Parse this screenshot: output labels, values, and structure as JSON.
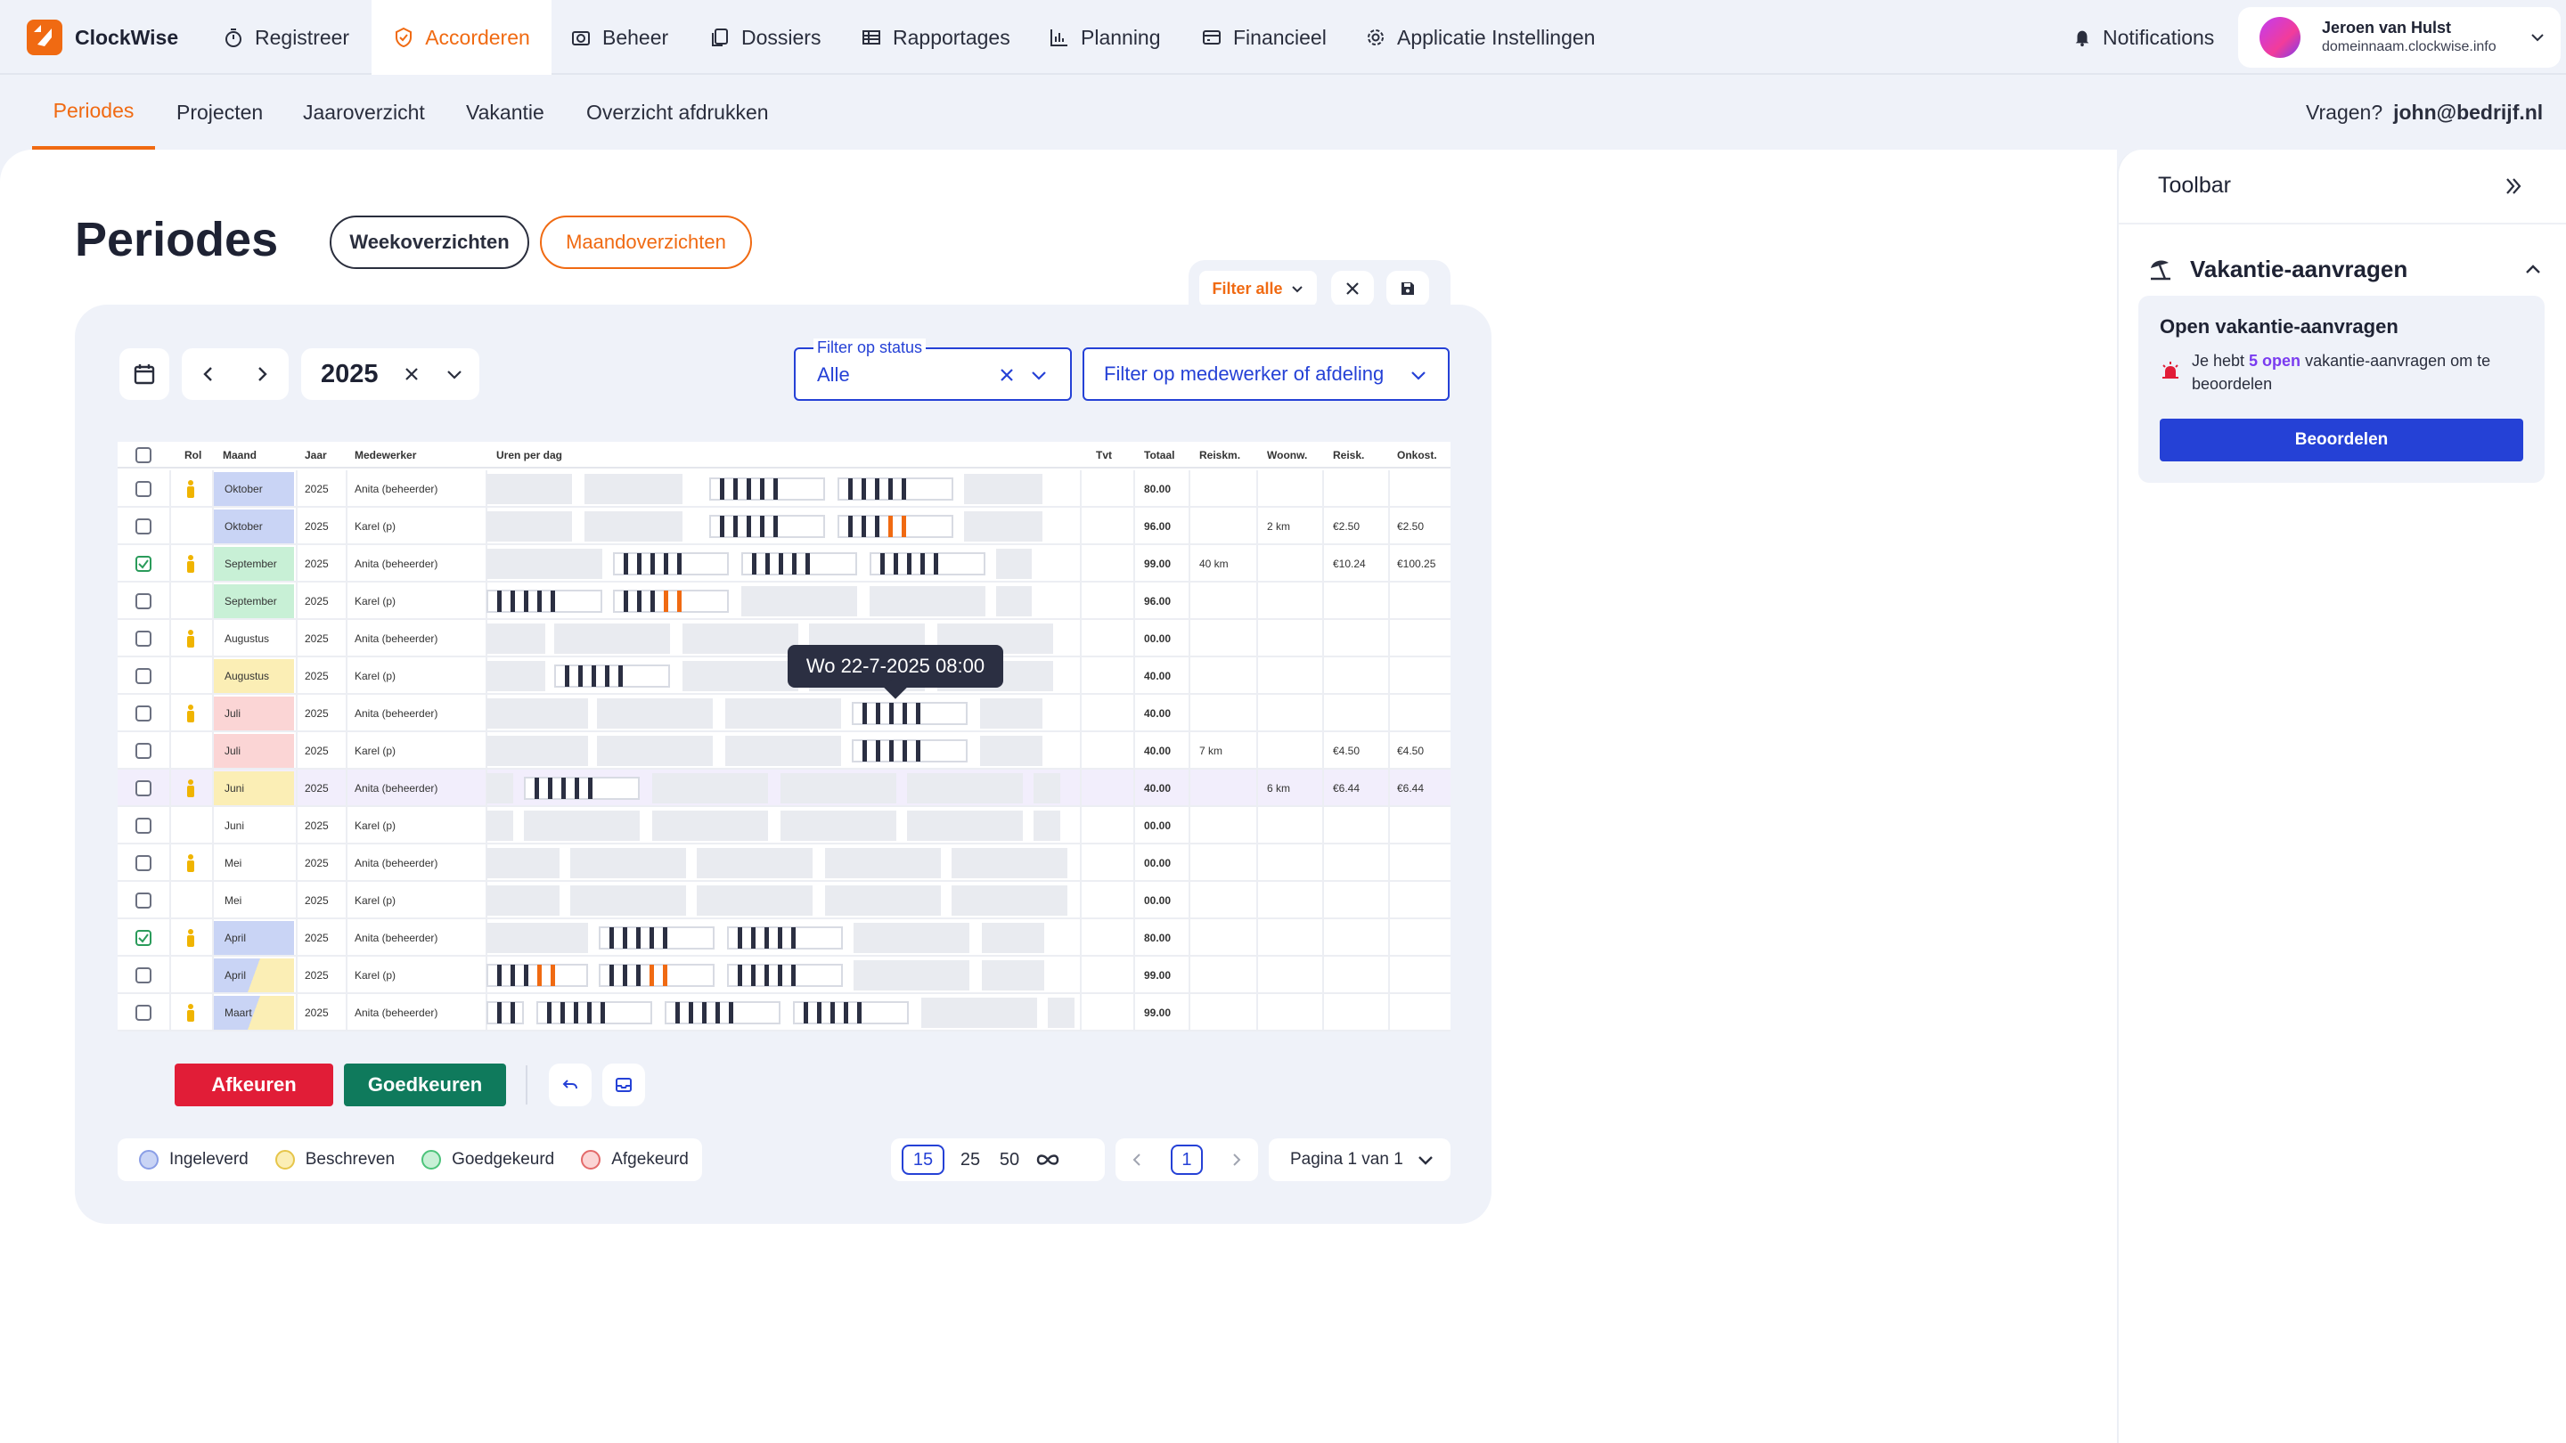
{
  "app": {
    "name": "ClockWise"
  },
  "nav": {
    "items": [
      {
        "label": "Registreer",
        "icon": "stopwatch-icon"
      },
      {
        "label": "Accorderen",
        "icon": "shield-check-icon",
        "active": true
      },
      {
        "label": "Beheer",
        "icon": "camera-icon"
      },
      {
        "label": "Dossiers",
        "icon": "copy-icon"
      },
      {
        "label": "Rapportages",
        "icon": "table-icon"
      },
      {
        "label": "Planning",
        "icon": "bar-chart-icon"
      },
      {
        "label": "Financieel",
        "icon": "wallet-icon"
      },
      {
        "label": "Applicatie Instellingen",
        "icon": "gear-icon"
      }
    ],
    "notifications": "Notifications",
    "user": {
      "name": "Jeroen van Hulst",
      "domain": "domeinnaam.clockwise.info"
    }
  },
  "subnav": {
    "items": [
      "Periodes",
      "Projecten",
      "Jaaroverzicht",
      "Vakantie",
      "Overzicht afdrukken"
    ],
    "help_label": "Vragen?",
    "help_email": "john@bedrijf.nl"
  },
  "page": {
    "title": "Periodes",
    "tab_week": "Weekoverzichten",
    "tab_month": "Maandoverzichten"
  },
  "filters": {
    "filter_all": "Filter alle",
    "year": "2025",
    "status_label": "Filter op status",
    "status_value": "Alle",
    "employee_placeholder": "Filter op medewerker of afdeling"
  },
  "table": {
    "headers": [
      "Rol",
      "Maand",
      "Jaar",
      "Medewerker",
      "Uren per dag",
      "Tvt",
      "Totaal",
      "Reiskm.",
      "Woonw.",
      "Reisk.",
      "Onkost."
    ],
    "rows": [
      {
        "checked": false,
        "role": true,
        "month": "Oktober",
        "status": "submitted",
        "year": "2025",
        "employee": "Anita (beheerder)",
        "total": "80.00",
        "reiskm": "",
        "woonw": "",
        "reisk": "",
        "onkost": ""
      },
      {
        "checked": false,
        "role": false,
        "month": "Oktober",
        "status": "submitted",
        "year": "2025",
        "employee": "Karel (p)",
        "total": "96.00",
        "reiskm": "",
        "woonw": "2 km",
        "reisk": "€2.50",
        "onkost": "€2.50"
      },
      {
        "checked": true,
        "role": true,
        "month": "September",
        "status": "approved",
        "year": "2025",
        "employee": "Anita (beheerder)",
        "total": "99.00",
        "reiskm": "40 km",
        "woonw": "",
        "reisk": "€10.24",
        "onkost": "€100.25"
      },
      {
        "checked": false,
        "role": false,
        "month": "September",
        "status": "approved",
        "year": "2025",
        "employee": "Karel (p)",
        "total": "96.00",
        "reiskm": "",
        "woonw": "",
        "reisk": "",
        "onkost": ""
      },
      {
        "checked": false,
        "role": true,
        "month": "Augustus",
        "status": "none",
        "year": "2025",
        "employee": "Anita (beheerder)",
        "total": "00.00",
        "reiskm": "",
        "woonw": "",
        "reisk": "",
        "onkost": ""
      },
      {
        "checked": false,
        "role": false,
        "month": "Augustus",
        "status": "written",
        "year": "2025",
        "employee": "Karel (p)",
        "total": "40.00",
        "reiskm": "",
        "woonw": "",
        "reisk": "",
        "onkost": ""
      },
      {
        "checked": false,
        "role": true,
        "month": "Juli",
        "status": "rejected",
        "year": "2025",
        "employee": "Anita (beheerder)",
        "total": "40.00",
        "reiskm": "",
        "woonw": "",
        "reisk": "",
        "onkost": ""
      },
      {
        "checked": false,
        "role": false,
        "month": "Juli",
        "status": "rejected",
        "year": "2025",
        "employee": "Karel (p)",
        "total": "40.00",
        "reiskm": "7 km",
        "woonw": "",
        "reisk": "€4.50",
        "onkost": "€4.50"
      },
      {
        "checked": false,
        "role": true,
        "month": "Juni",
        "status": "written",
        "year": "2025",
        "employee": "Anita (beheerder)",
        "total": "40.00",
        "reiskm": "",
        "woonw": "6 km",
        "reisk": "€6.44",
        "onkost": "€6.44",
        "highlight": true
      },
      {
        "checked": false,
        "role": false,
        "month": "Juni",
        "status": "none",
        "year": "2025",
        "employee": "Karel (p)",
        "total": "00.00",
        "reiskm": "",
        "woonw": "",
        "reisk": "",
        "onkost": ""
      },
      {
        "checked": false,
        "role": true,
        "month": "Mei",
        "status": "none",
        "year": "2025",
        "employee": "Anita (beheerder)",
        "total": "00.00",
        "reiskm": "",
        "woonw": "",
        "reisk": "",
        "onkost": ""
      },
      {
        "checked": false,
        "role": false,
        "month": "Mei",
        "status": "none",
        "year": "2025",
        "employee": "Karel (p)",
        "total": "00.00",
        "reiskm": "",
        "woonw": "",
        "reisk": "",
        "onkost": ""
      },
      {
        "checked": true,
        "role": true,
        "month": "April",
        "status": "submitted",
        "year": "2025",
        "employee": "Anita (beheerder)",
        "total": "80.00",
        "reiskm": "",
        "woonw": "",
        "reisk": "",
        "onkost": ""
      },
      {
        "checked": false,
        "role": false,
        "month": "April",
        "status": "mixed",
        "year": "2025",
        "employee": "Karel (p)",
        "total": "99.00",
        "reiskm": "",
        "woonw": "",
        "reisk": "",
        "onkost": ""
      },
      {
        "checked": false,
        "role": true,
        "month": "Maart",
        "status": "mixed",
        "year": "2025",
        "employee": "Anita (beheerder)",
        "total": "99.00",
        "reiskm": "",
        "woonw": "",
        "reisk": "",
        "onkost": ""
      }
    ],
    "tooltip": "Wo 22-7-2025 08:00"
  },
  "actions": {
    "reject": "Afkeuren",
    "approve": "Goedkeuren"
  },
  "legend": [
    {
      "label": "Ingeleverd",
      "color": "#c9d4f5",
      "border": "#8a9ee6"
    },
    {
      "label": "Beschreven",
      "color": "#fbeeb5",
      "border": "#e6c54a"
    },
    {
      "label": "Goedgekeurd",
      "color": "#c8f0d6",
      "border": "#4cc37a"
    },
    {
      "label": "Afgekeurd",
      "color": "#fbd5d5",
      "border": "#e36a6a"
    }
  ],
  "pagination": {
    "sizes": [
      "15",
      "25",
      "50"
    ],
    "page": "1",
    "page_label": "Pagina 1 van 1"
  },
  "toolbar": {
    "title": "Toolbar",
    "section": "Vakantie-aanvragen",
    "card_title": "Open vakantie-aanvragen",
    "text_pre": "Je hebt ",
    "text_count": "5 open",
    "text_post": " vakantie-aanvragen om te beoordelen",
    "button": "Beoordelen"
  },
  "colors": {
    "accent": "#f06a12",
    "approve": "#0f7a5c",
    "reject": "#e11d37",
    "primary": "#2541d6",
    "purple": "#7a3cf0"
  }
}
